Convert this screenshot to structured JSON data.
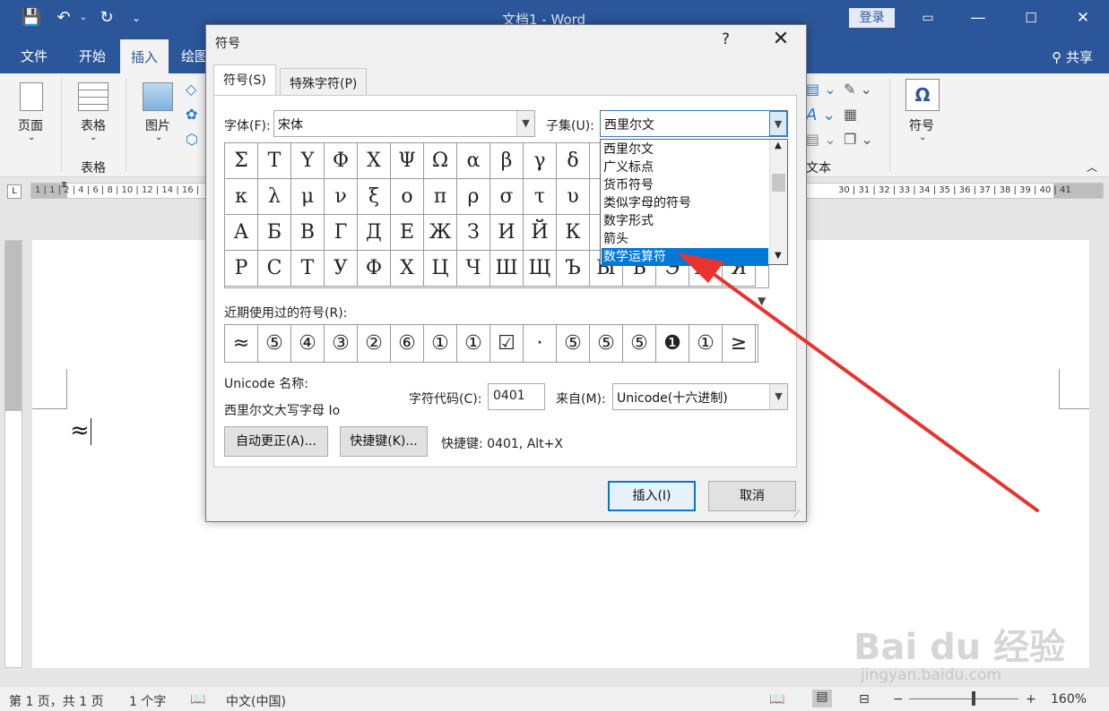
{
  "window": {
    "doc_title": "文档1  -  Word",
    "login": "登录",
    "save_icon": "save-icon",
    "undo_icon": "undo-icon",
    "redo_icon": "redo-icon"
  },
  "tabs": [
    {
      "label": "文件"
    },
    {
      "label": "开始"
    },
    {
      "label": "插入"
    },
    {
      "label": "绘图"
    }
  ],
  "share": "共享",
  "ribbon": {
    "page": "页面",
    "table": "表格",
    "table_group": "表格",
    "picture": "图片",
    "symbol": "符号",
    "text_group": "文本",
    "omega": "Ω"
  },
  "ruler": {
    "left_text": "1 | 1 | 2 | 4 | 6 | 8 | 10 | 12 | 14 | 16 |",
    "right_text": "30 | 31 | 32 | 33 | 34 | 35 | 36 | 37 | 38 | 39 | 40 | 41"
  },
  "document": {
    "text": "≈"
  },
  "status": {
    "page": "第 1 页，共 1 页",
    "words": "1 个字",
    "lang": "中文(中国)",
    "zoom": "160%"
  },
  "dialog": {
    "title": "符号",
    "help": "?",
    "close": "✕",
    "tab_symbols": "符号(S)",
    "tab_special": "特殊字符(P)",
    "font_label": "字体(F):",
    "font_value": "宋体",
    "subset_label": "子集(U):",
    "subset_value": "西里尔文",
    "subset_options": [
      "西里尔文",
      "广义标点",
      "货币符号",
      "类似字母的符号",
      "数字形式",
      "箭头",
      "数学运算符"
    ],
    "subset_selected_index": 6,
    "grid_rows": [
      [
        "Σ",
        "Τ",
        "Υ",
        "Φ",
        "Χ",
        "Ψ",
        "Ω",
        "α",
        "β",
        "γ",
        "δ",
        "",
        "",
        "",
        "",
        "",
        ""
      ],
      [
        "κ",
        "λ",
        "μ",
        "ν",
        "ξ",
        "ο",
        "π",
        "ρ",
        "σ",
        "τ",
        "υ",
        "",
        "",
        "",
        "",
        "",
        ""
      ],
      [
        "А",
        "Б",
        "В",
        "Г",
        "Д",
        "Е",
        "Ж",
        "З",
        "И",
        "Й",
        "К",
        "",
        "",
        "",
        "",
        "",
        ""
      ],
      [
        "Р",
        "С",
        "Т",
        "У",
        "Ф",
        "Х",
        "Ц",
        "Ч",
        "Ш",
        "Щ",
        "Ъ",
        "Ы",
        "Ь",
        "Э",
        "Ю",
        "Я"
      ]
    ],
    "recent_label": "近期使用过的符号(R):",
    "recent": [
      "≈",
      "⑤",
      "④",
      "③",
      "②",
      "⑥",
      "①",
      "①",
      "☑",
      "·",
      "⑤",
      "⑤",
      "⑤",
      "❶",
      "①",
      "≥"
    ],
    "unicode_label": "Unicode 名称:",
    "unicode_name": "西里尔文大写字母 Io",
    "char_code_label": "字符代码(C):",
    "char_code": "0401",
    "from_label": "来自(M):",
    "from_value": "Unicode(十六进制)",
    "autocorrect": "自动更正(A)...",
    "shortcut_key": "快捷键(K)...",
    "shortcut_text": "快捷键: 0401, Alt+X",
    "insert": "插入(I)",
    "cancel": "取消"
  },
  "watermark": {
    "brand": "Bai du 经验",
    "url": "jingyan.baidu.com"
  },
  "colors": {
    "word_blue": "#2b579a",
    "selection": "#0078d7",
    "annotation": "#e8332f"
  }
}
